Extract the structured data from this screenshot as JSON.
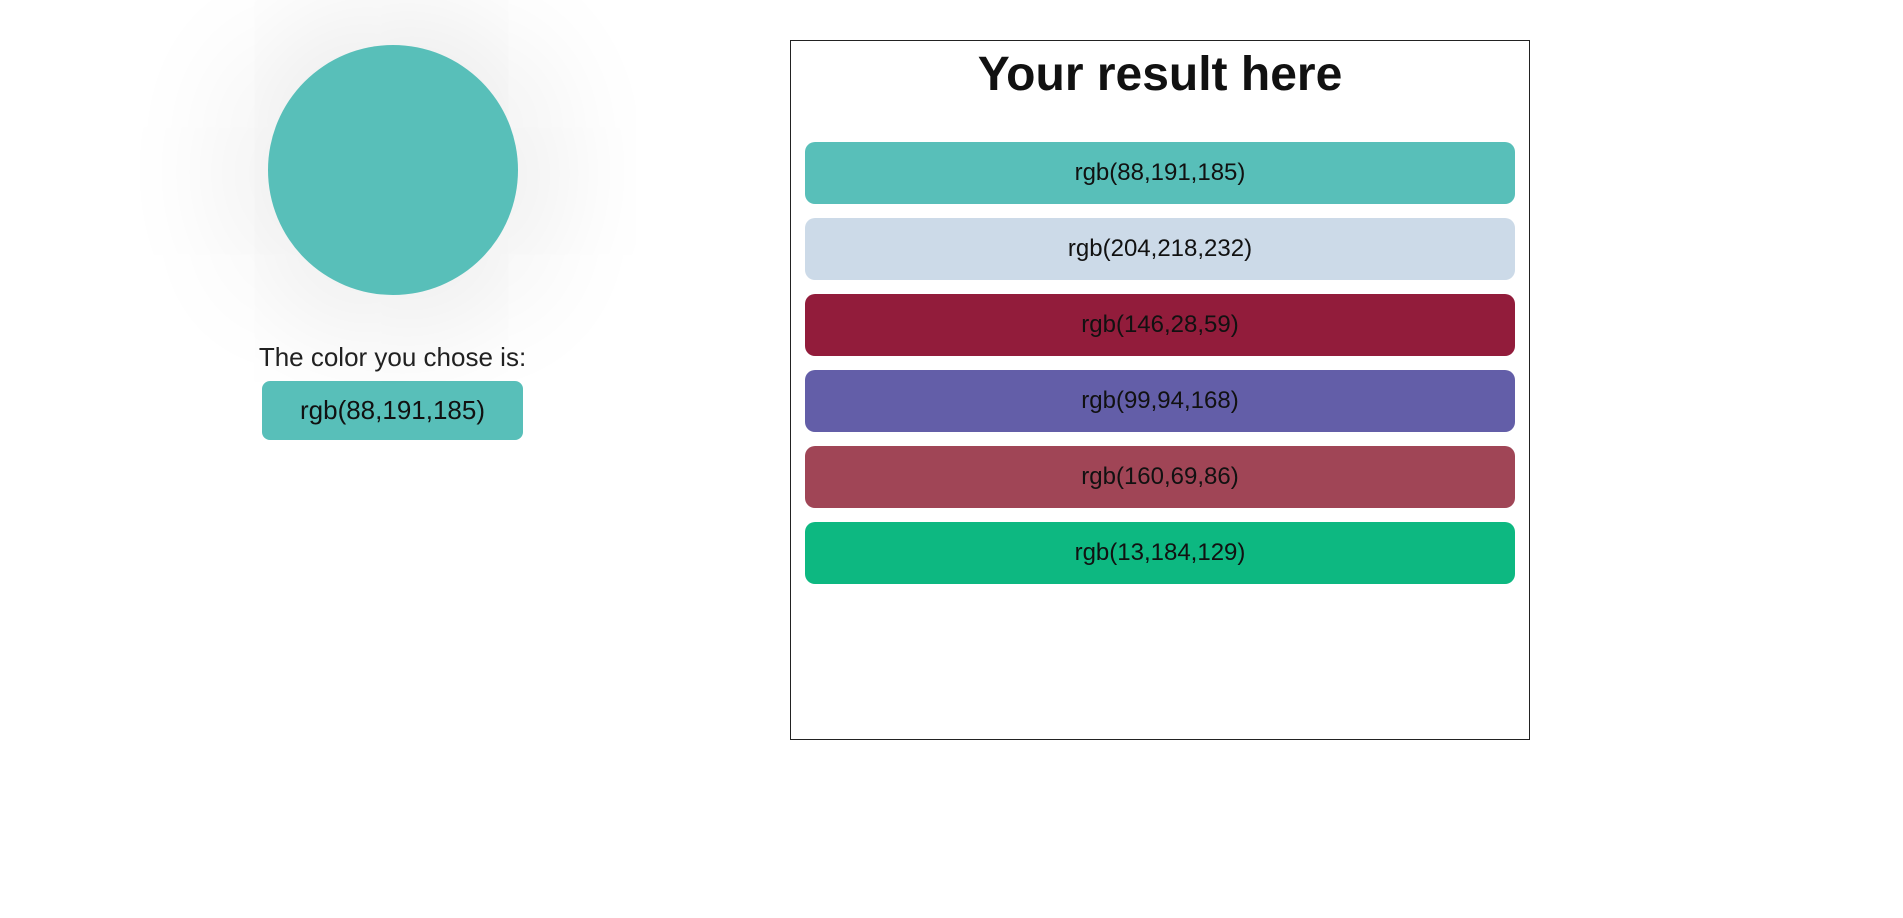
{
  "left": {
    "selected_color": "rgb(88,191,185)",
    "label": "The color you chose is:",
    "value_text": "rgb(88,191,185)"
  },
  "right": {
    "title": "Your result here",
    "items": [
      {
        "text": "rgb(88,191,185)",
        "color": "rgb(88,191,185)"
      },
      {
        "text": "rgb(204,218,232)",
        "color": "rgb(204,218,232)"
      },
      {
        "text": "rgb(146,28,59)",
        "color": "rgb(146,28,59)"
      },
      {
        "text": "rgb(99,94,168)",
        "color": "rgb(99,94,168)"
      },
      {
        "text": "rgb(160,69,86)",
        "color": "rgb(160,69,86)"
      },
      {
        "text": "rgb(13,184,129)",
        "color": "rgb(13,184,129)"
      }
    ]
  }
}
